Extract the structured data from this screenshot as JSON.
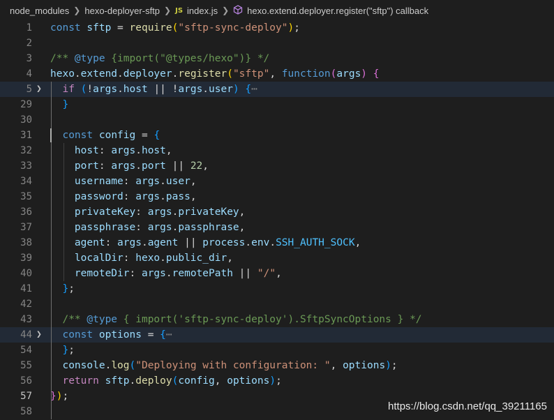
{
  "breadcrumb": {
    "items": [
      "node_modules",
      "hexo-deployer-sftp",
      "index.js",
      "hexo.extend.deployer.register(\"sftp\") callback"
    ],
    "js_badge": "JS"
  },
  "editor": {
    "lines": [
      {
        "no": "1",
        "tokens": [
          [
            "k",
            "const "
          ],
          [
            "v",
            "sftp"
          ],
          [
            "o",
            " = "
          ],
          [
            "f",
            "require"
          ],
          [
            "br1",
            "("
          ],
          [
            "s",
            "\"sftp-sync-deploy\""
          ],
          [
            "br1",
            ")"
          ],
          [
            "o",
            ";"
          ]
        ]
      },
      {
        "no": "2",
        "tokens": []
      },
      {
        "no": "3",
        "tokens": [
          [
            "c",
            "/** "
          ],
          [
            "cc",
            "@type"
          ],
          [
            "c",
            " {import(\"@types/hexo\")} */"
          ]
        ]
      },
      {
        "no": "4",
        "tokens": [
          [
            "v",
            "hexo"
          ],
          [
            "o",
            "."
          ],
          [
            "v",
            "extend"
          ],
          [
            "o",
            "."
          ],
          [
            "v",
            "deployer"
          ],
          [
            "o",
            "."
          ],
          [
            "f",
            "register"
          ],
          [
            "br1",
            "("
          ],
          [
            "s",
            "\"sftp\""
          ],
          [
            "o",
            ", "
          ],
          [
            "k",
            "function"
          ],
          [
            "br2",
            "("
          ],
          [
            "v",
            "args"
          ],
          [
            "br2",
            ")"
          ],
          [
            "o",
            " "
          ],
          [
            "br2",
            "{"
          ]
        ]
      },
      {
        "no": "5",
        "fold": true,
        "highlight": true,
        "tokens": [
          [
            "o",
            "  "
          ],
          [
            "kc",
            "if"
          ],
          [
            "o",
            " "
          ],
          [
            "br3",
            "("
          ],
          [
            "o",
            "!"
          ],
          [
            "v",
            "args"
          ],
          [
            "o",
            "."
          ],
          [
            "v",
            "host"
          ],
          [
            "o",
            " || !"
          ],
          [
            "v",
            "args"
          ],
          [
            "o",
            "."
          ],
          [
            "v",
            "user"
          ],
          [
            "br3",
            ")"
          ],
          [
            "o",
            " "
          ],
          [
            "br3",
            "{"
          ],
          [
            "ellip",
            "⋯"
          ]
        ]
      },
      {
        "no": "29",
        "tokens": [
          [
            "o",
            "  "
          ],
          [
            "br3",
            "}"
          ]
        ]
      },
      {
        "no": "30",
        "tokens": []
      },
      {
        "no": "31",
        "tokens": [
          [
            "o",
            "  "
          ],
          [
            "k",
            "const "
          ],
          [
            "v",
            "config"
          ],
          [
            "o",
            " = "
          ],
          [
            "br3",
            "{"
          ]
        ]
      },
      {
        "no": "32",
        "tokens": [
          [
            "o",
            "    "
          ],
          [
            "v",
            "host"
          ],
          [
            "o",
            ": "
          ],
          [
            "v",
            "args"
          ],
          [
            "o",
            "."
          ],
          [
            "v",
            "host"
          ],
          [
            "o",
            ","
          ]
        ]
      },
      {
        "no": "33",
        "tokens": [
          [
            "o",
            "    "
          ],
          [
            "v",
            "port"
          ],
          [
            "o",
            ": "
          ],
          [
            "v",
            "args"
          ],
          [
            "o",
            "."
          ],
          [
            "v",
            "port"
          ],
          [
            "o",
            " || "
          ],
          [
            "n",
            "22"
          ],
          [
            "o",
            ","
          ]
        ]
      },
      {
        "no": "34",
        "tokens": [
          [
            "o",
            "    "
          ],
          [
            "v",
            "username"
          ],
          [
            "o",
            ": "
          ],
          [
            "v",
            "args"
          ],
          [
            "o",
            "."
          ],
          [
            "v",
            "user"
          ],
          [
            "o",
            ","
          ]
        ]
      },
      {
        "no": "35",
        "tokens": [
          [
            "o",
            "    "
          ],
          [
            "v",
            "password"
          ],
          [
            "o",
            ": "
          ],
          [
            "v",
            "args"
          ],
          [
            "o",
            "."
          ],
          [
            "v",
            "pass"
          ],
          [
            "o",
            ","
          ]
        ]
      },
      {
        "no": "36",
        "tokens": [
          [
            "o",
            "    "
          ],
          [
            "v",
            "privateKey"
          ],
          [
            "o",
            ": "
          ],
          [
            "v",
            "args"
          ],
          [
            "o",
            "."
          ],
          [
            "v",
            "privateKey"
          ],
          [
            "o",
            ","
          ]
        ]
      },
      {
        "no": "37",
        "tokens": [
          [
            "o",
            "    "
          ],
          [
            "v",
            "passphrase"
          ],
          [
            "o",
            ": "
          ],
          [
            "v",
            "args"
          ],
          [
            "o",
            "."
          ],
          [
            "v",
            "passphrase"
          ],
          [
            "o",
            ","
          ]
        ]
      },
      {
        "no": "38",
        "tokens": [
          [
            "o",
            "    "
          ],
          [
            "v",
            "agent"
          ],
          [
            "o",
            ": "
          ],
          [
            "v",
            "args"
          ],
          [
            "o",
            "."
          ],
          [
            "v",
            "agent"
          ],
          [
            "o",
            " || "
          ],
          [
            "v",
            "process"
          ],
          [
            "o",
            "."
          ],
          [
            "v",
            "env"
          ],
          [
            "o",
            "."
          ],
          [
            "co",
            "SSH_AUTH_SOCK"
          ],
          [
            "o",
            ","
          ]
        ]
      },
      {
        "no": "39",
        "tokens": [
          [
            "o",
            "    "
          ],
          [
            "v",
            "localDir"
          ],
          [
            "o",
            ": "
          ],
          [
            "v",
            "hexo"
          ],
          [
            "o",
            "."
          ],
          [
            "v",
            "public_dir"
          ],
          [
            "o",
            ","
          ]
        ]
      },
      {
        "no": "40",
        "tokens": [
          [
            "o",
            "    "
          ],
          [
            "v",
            "remoteDir"
          ],
          [
            "o",
            ": "
          ],
          [
            "v",
            "args"
          ],
          [
            "o",
            "."
          ],
          [
            "v",
            "remotePath"
          ],
          [
            "o",
            " || "
          ],
          [
            "s",
            "\"/\""
          ],
          [
            "o",
            ","
          ]
        ]
      },
      {
        "no": "41",
        "tokens": [
          [
            "o",
            "  "
          ],
          [
            "br3",
            "}"
          ],
          [
            "o",
            ";"
          ]
        ]
      },
      {
        "no": "42",
        "tokens": []
      },
      {
        "no": "43",
        "tokens": [
          [
            "o",
            "  "
          ],
          [
            "c",
            "/** "
          ],
          [
            "cc",
            "@type"
          ],
          [
            "c",
            " { import('sftp-sync-deploy').SftpSyncOptions } */"
          ]
        ]
      },
      {
        "no": "44",
        "fold": true,
        "highlight": true,
        "tokens": [
          [
            "o",
            "  "
          ],
          [
            "k",
            "const "
          ],
          [
            "v",
            "options"
          ],
          [
            "o",
            " = "
          ],
          [
            "br3",
            "{"
          ],
          [
            "ellip",
            "⋯"
          ]
        ]
      },
      {
        "no": "54",
        "tokens": [
          [
            "o",
            "  "
          ],
          [
            "br3",
            "}"
          ],
          [
            "o",
            ";"
          ]
        ]
      },
      {
        "no": "55",
        "tokens": [
          [
            "o",
            "  "
          ],
          [
            "v",
            "console"
          ],
          [
            "o",
            "."
          ],
          [
            "f",
            "log"
          ],
          [
            "br3",
            "("
          ],
          [
            "s",
            "\"Deploying with configuration: \""
          ],
          [
            "o",
            ", "
          ],
          [
            "v",
            "options"
          ],
          [
            "br3",
            ")"
          ],
          [
            "o",
            ";"
          ]
        ]
      },
      {
        "no": "56",
        "tokens": [
          [
            "o",
            "  "
          ],
          [
            "kc",
            "return "
          ],
          [
            "v",
            "sftp"
          ],
          [
            "o",
            "."
          ],
          [
            "f",
            "deploy"
          ],
          [
            "br3",
            "("
          ],
          [
            "v",
            "config"
          ],
          [
            "o",
            ", "
          ],
          [
            "v",
            "options"
          ],
          [
            "br3",
            ")"
          ],
          [
            "o",
            ";"
          ]
        ]
      },
      {
        "no": "57",
        "active": true,
        "tokens": [
          [
            "br2",
            "}"
          ],
          [
            "br1",
            ")"
          ],
          [
            "o",
            ";"
          ]
        ]
      },
      {
        "no": "58",
        "tokens": []
      }
    ]
  },
  "watermark": "https://blog.csdn.net/qq_39211165"
}
